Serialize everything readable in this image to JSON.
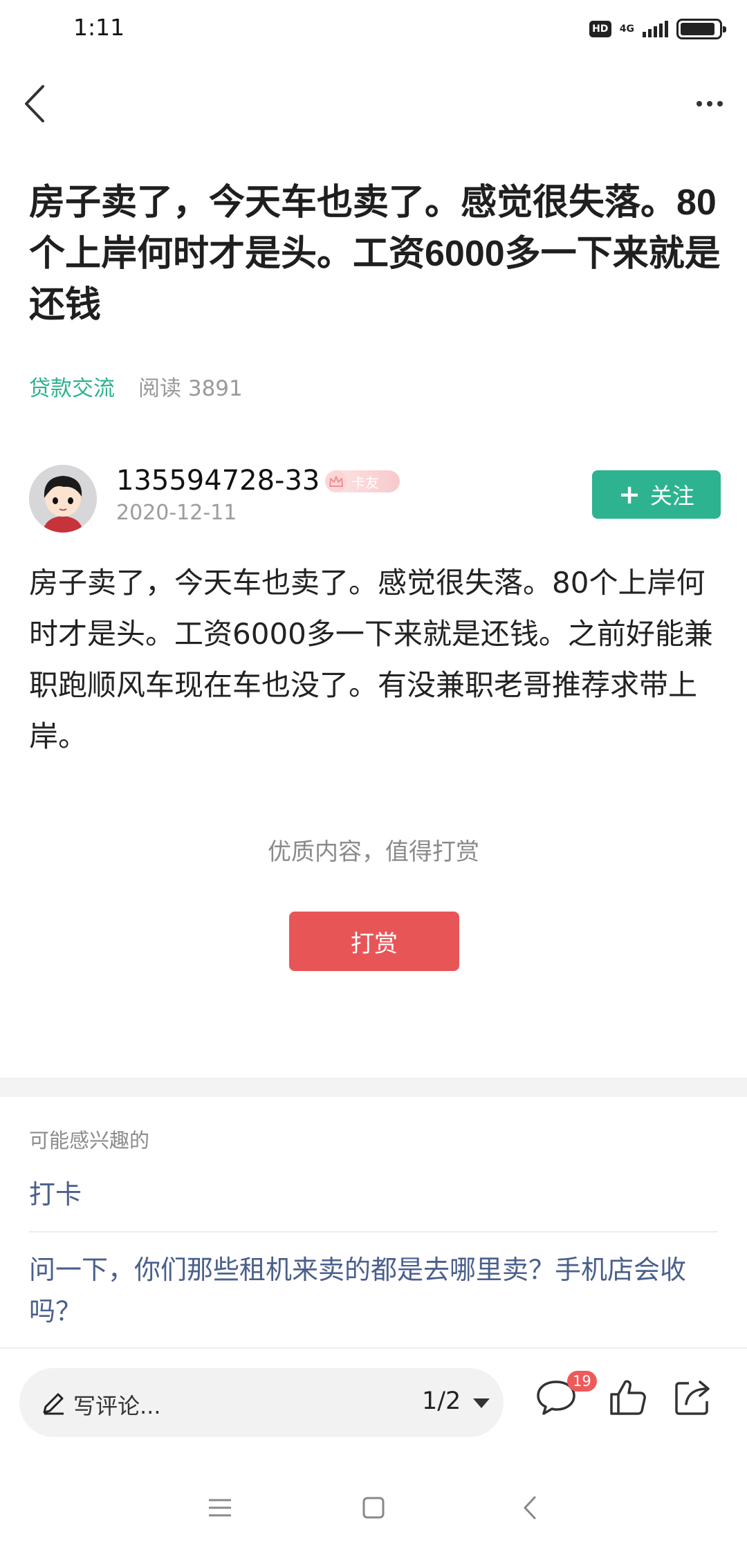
{
  "status_bar": {
    "time": "1:11",
    "hd": "HD",
    "network": "4G",
    "battery_level": 0.9
  },
  "nav": {
    "back_icon": "chevron-left-icon",
    "more_icon": "more-dots-icon"
  },
  "post": {
    "title": "房子卖了，今天车也卖了。感觉很失落。80个上岸何时才是头。工资6000多一下来就是还钱",
    "category": "贷款交流",
    "reads": "阅读 3891",
    "author": {
      "name": "135594728-33",
      "badge": "卡友",
      "date": "2020-12-11"
    },
    "follow_label": "关注",
    "body": "房子卖了，今天车也卖了。感觉很失落。80个上岸何时才是头。工资6000多一下来就是还钱。之前好能兼职跑顺风车现在车也没了。有没兼职老哥推荐求带上岸。"
  },
  "reward": {
    "prompt": "优质内容，值得打赏",
    "button_label": "打赏"
  },
  "related": {
    "heading": "可能感兴趣的",
    "items": [
      "打卡",
      "问一下，你们那些租机来卖的都是去哪里卖？手机店会收吗？"
    ]
  },
  "toolbar": {
    "comment_placeholder": "写评论...",
    "page_indicator": "1/2",
    "comment_count": "19"
  },
  "colors": {
    "accent_green": "#2db38f",
    "reward_red": "#e85557",
    "link_blue": "#4a5f8c",
    "badge_red": "#ed5a5a"
  }
}
